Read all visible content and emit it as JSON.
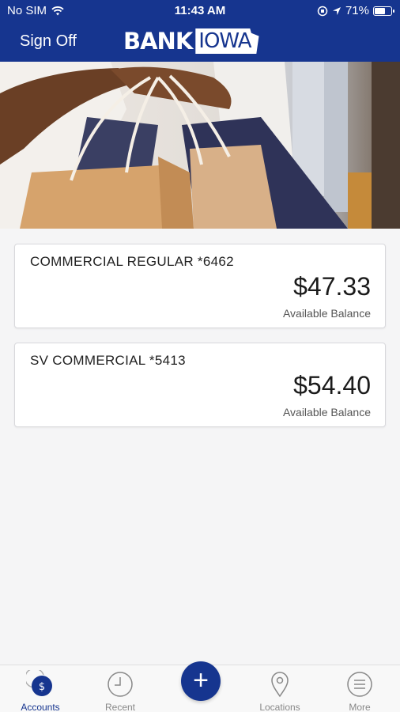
{
  "status_bar": {
    "carrier": "No SIM",
    "time": "11:43 AM",
    "battery_percent": "71%",
    "battery_level": 0.71
  },
  "header": {
    "sign_off_label": "Sign Off",
    "logo_bank": "BANK",
    "logo_iowa": "IOWA",
    "background_color": "#16358f"
  },
  "accounts": [
    {
      "name": "COMMERCIAL REGULAR *6462",
      "balance": "$47.33",
      "balance_label": "Available Balance"
    },
    {
      "name": "SV COMMERCIAL *5413",
      "balance": "$54.40",
      "balance_label": "Available Balance"
    }
  ],
  "tabs": [
    {
      "label": "Accounts",
      "icon": "dollar-icon",
      "active": true
    },
    {
      "label": "Recent",
      "icon": "clock-icon",
      "active": false
    },
    {
      "label": "add",
      "icon": "plus-icon",
      "active": false
    },
    {
      "label": "Locations",
      "icon": "location-pin-icon",
      "active": false
    },
    {
      "label": "More",
      "icon": "menu-icon",
      "active": false
    }
  ],
  "fab_symbol": "+"
}
